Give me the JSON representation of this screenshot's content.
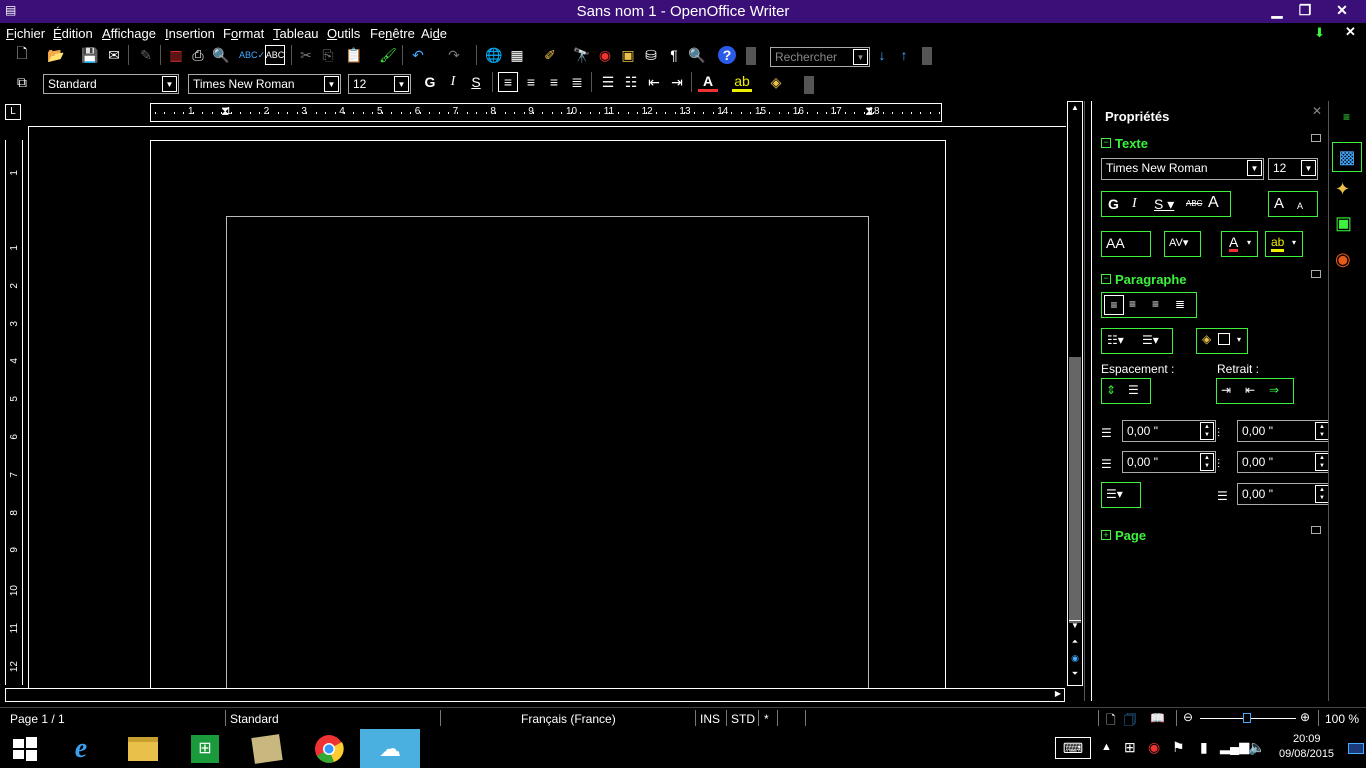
{
  "window": {
    "title": "Sans nom 1 - OpenOffice Writer"
  },
  "menus": [
    {
      "label": "Fichier",
      "u": "F"
    },
    {
      "label": "Édition",
      "u": "É"
    },
    {
      "label": "Affichage",
      "u": "A"
    },
    {
      "label": "Insertion",
      "u": "I"
    },
    {
      "label": "Format",
      "u": "o"
    },
    {
      "label": "Tableau",
      "u": "T"
    },
    {
      "label": "Outils",
      "u": "O"
    },
    {
      "label": "Fenêtre",
      "u": "n"
    },
    {
      "label": "Aide",
      "u": "d"
    }
  ],
  "toolbar": {
    "search_placeholder": "Rechercher"
  },
  "formatting": {
    "style": "Standard",
    "font": "Times New Roman",
    "size": "12",
    "bold": "G",
    "italic": "I",
    "underline": "S"
  },
  "ruler_h": [
    "1",
    "1",
    "2",
    "3",
    "4",
    "5",
    "6",
    "7",
    "8",
    "9",
    "10",
    "11",
    "12",
    "13",
    "14",
    "15",
    "16",
    "17",
    "18"
  ],
  "ruler_v": [
    "1",
    "1",
    "2",
    "3",
    "4",
    "5",
    "6",
    "7",
    "8",
    "9",
    "10",
    "11",
    "12"
  ],
  "sidebar": {
    "title": "Propriétés",
    "text_section": "Texte",
    "font": "Times New Roman",
    "size": "12",
    "paragraph_section": "Paragraphe",
    "spacing_label": "Espacement :",
    "indent_label": "Retrait :",
    "spin_values": [
      "0,00 \"",
      "0,00 \"",
      "0,00 \"",
      "0,00 \"",
      "0,00 \""
    ],
    "page_section": "Page"
  },
  "status": {
    "page": "Page 1 / 1",
    "style": "Standard",
    "language": "Français (France)",
    "ins": "INS",
    "std": "STD",
    "modified": "*",
    "zoom": "100 %"
  },
  "clock": {
    "time": "20:09",
    "date": "09/08/2015"
  },
  "colors": {
    "titlebar": "#3a1078",
    "accent": "#3df23d"
  }
}
